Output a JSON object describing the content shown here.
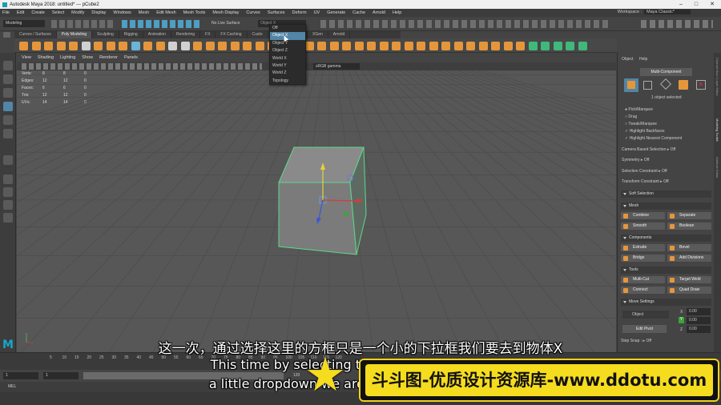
{
  "window": {
    "title": "Autodesk Maya 2018: untitled*  ---  pCube2"
  },
  "menu": [
    "File",
    "Edit",
    "Create",
    "Select",
    "Modify",
    "Display",
    "Windows",
    "Mesh",
    "Edit Mesh",
    "Mesh Tools",
    "Mesh Display",
    "Curves",
    "Surfaces",
    "Deform",
    "UV",
    "Generate",
    "Cache",
    "Arnold",
    "Help"
  ],
  "workspace": {
    "label": "Workspace :",
    "value": "Maya Classic*"
  },
  "statusline": {
    "mode": "Modeling",
    "live_surface": "No Live Surface",
    "symmetry_value": "Object X"
  },
  "shelf_tabs": [
    "Curves / Surfaces",
    "Poly Modeling",
    "Sculpting",
    "Rigging",
    "Animation",
    "Rendering",
    "FX",
    "FX Caching",
    "Custo",
    "Motion Graphics",
    "XGen",
    "Arnold"
  ],
  "shelf_active": "Poly Modeling",
  "viewport": {
    "menu": [
      "View",
      "Shading",
      "Lighting",
      "Show",
      "Renderer",
      "Panels"
    ],
    "gamma": "sRGB gamma",
    "camera": "persp",
    "hud": [
      {
        "label": "Verts:",
        "a": "8",
        "b": "8",
        "c": "0"
      },
      {
        "label": "Edges:",
        "a": "12",
        "b": "12",
        "c": "0"
      },
      {
        "label": "Faces:",
        "a": "6",
        "b": "6",
        "c": "0"
      },
      {
        "label": "Tris:",
        "a": "12",
        "b": "12",
        "c": "0"
      },
      {
        "label": "UVs:",
        "a": "14",
        "b": "14",
        "c": "0"
      }
    ]
  },
  "dropdown": {
    "items": [
      "Off",
      "Object X",
      "Object Y",
      "Object Z",
      "World X",
      "World Y",
      "World Z",
      "Topology"
    ],
    "selected": "Object X"
  },
  "attr": {
    "tabs": [
      "Object",
      "Help"
    ],
    "multi_component": "Multi-Component",
    "selected_count": "1 object selected",
    "pick_marquee": "Pick/Marquee",
    "drag": "Drag",
    "tweak_marquee": "Tweak/Marquee",
    "highlight_backfaces": "Highlight Backfaces",
    "highlight_nearest": "Highlight Nearest Component",
    "camera_based": "Camera Based Selection",
    "camera_based_val": "Off",
    "symmetry": "Symmetry",
    "symmetry_val": "Off",
    "selection_constraint": "Selection Constraint",
    "selection_constraint_val": "Off",
    "transform_constraint": "Transform Constraint",
    "transform_constraint_val": "Off",
    "soft_selection": "Soft Selection",
    "mesh": "Mesh",
    "combine": "Combine",
    "separate": "Separate",
    "smooth": "Smooth",
    "boolean": "Boolean",
    "components": "Components",
    "extrude": "Extrude",
    "bevel": "Bevel",
    "bridge": "Bridge",
    "add_divisions": "Add Divisions",
    "tools": "Tools",
    "multi_cut": "Multi-Cut",
    "target_weld": "Target Weld",
    "connect": "Connect",
    "quad_draw": "Quad Draw",
    "move_settings": "Move Settings",
    "move_object": "Object",
    "x_val": "0.00",
    "y_val": "0.00",
    "z_val": "0.00",
    "edit_pivot": "Edit Pivot",
    "step_snap": "Step Snap :",
    "step_snap_val": "Off"
  },
  "side_tabs": [
    "Channel Box / Layer Editor",
    "Modeling Toolkit",
    "Attribute Editor"
  ],
  "timeline": {
    "ticks": [
      "5",
      "10",
      "15",
      "20",
      "25",
      "30",
      "35",
      "40",
      "45",
      "50",
      "55",
      "60",
      "65",
      "70",
      "75",
      "80",
      "85",
      "90",
      "95",
      "100",
      "105",
      "110",
      "115",
      "120"
    ],
    "start": "1",
    "end": "120",
    "range_start": "1",
    "range_end": "120"
  },
  "commandline": {
    "label": "MEL"
  },
  "subtitles": {
    "cn": "这一次，通过选择这里的方框只是一个小的下拉框我们要去到物体X",
    "en1": "This time by selecting the box here is just",
    "en2": "a little dropdown we are going to Object X"
  },
  "watermark": "斗斗图-优质设计资源库-www.ddotu.com"
}
